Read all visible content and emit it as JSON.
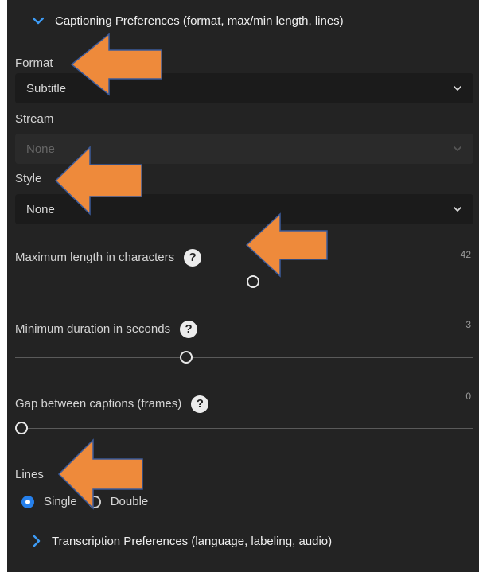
{
  "captioning": {
    "header": "Captioning Preferences (format, max/min length, lines)",
    "format": {
      "label": "Format",
      "value": "Subtitle"
    },
    "stream": {
      "label": "Stream",
      "value": "None"
    },
    "style": {
      "label": "Style",
      "value": "None"
    },
    "max_length": {
      "label": "Maximum length in characters",
      "value": "42",
      "help": "?",
      "level": 0.52
    },
    "min_duration": {
      "label": "Minimum duration in seconds",
      "value": "3",
      "help": "?",
      "level": 0.37
    },
    "gap": {
      "label": "Gap between captions (frames)",
      "value": "0",
      "help": "?",
      "level": 0.0
    },
    "lines": {
      "label": "Lines",
      "options": [
        {
          "label": "Single",
          "selected": true
        },
        {
          "label": "Double",
          "selected": false
        }
      ]
    }
  },
  "transcription": {
    "header": "Transcription Preferences (language, labeling, audio)"
  },
  "colors": {
    "panel_bg": "#232323",
    "accent": "#2680eb",
    "annotation_arrow": "#ee8a3b"
  }
}
